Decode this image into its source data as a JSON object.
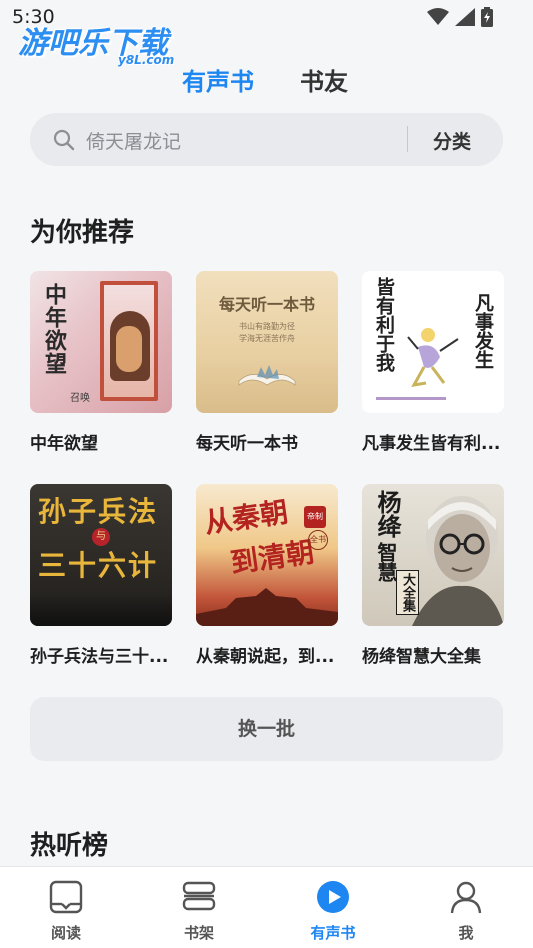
{
  "status_bar": {
    "time": "5:30",
    "icons": [
      "wifi-icon",
      "signal-icon",
      "battery-icon"
    ]
  },
  "watermark": {
    "main": "游吧乐下载",
    "sub": "y8L.com"
  },
  "top_tabs": [
    {
      "label": "有声书",
      "active": true
    },
    {
      "label": "书友",
      "active": false
    }
  ],
  "search": {
    "placeholder": "倚天屠龙记",
    "category_label": "分类"
  },
  "recommend": {
    "title": "为你推荐",
    "books": [
      {
        "title": "中年欲望",
        "cover_text": "中年欲望",
        "cover_author": "召唤"
      },
      {
        "title": "每天听一本书",
        "cover_text": "每天听一本书",
        "cover_sub1": "书山有路勤为径",
        "cover_sub2": "学海无涯苦作舟"
      },
      {
        "title": "凡事发生皆有利...",
        "cover_text1": "凡事发生",
        "cover_text2": "皆有利于我"
      },
      {
        "title": "孙子兵法与三十...",
        "cover_text1": "孙子兵法",
        "cover_mid": "与",
        "cover_text2": "三十六计"
      },
      {
        "title": "从秦朝说起，到...",
        "cover_text1": "从秦朝",
        "cover_text2": "到清朝",
        "cover_badge1": "帝制",
        "cover_badge2": "全书"
      },
      {
        "title": "杨绛智慧大全集",
        "cover_text1": "杨绛",
        "cover_text2": "智慧",
        "cover_text3": "大全集"
      }
    ]
  },
  "refresh_label": "换一批",
  "hot": {
    "title": "热听榜"
  },
  "bottom_nav": [
    {
      "label": "阅读",
      "icon": "tablet-icon",
      "active": false
    },
    {
      "label": "书架",
      "icon": "bookshelf-icon",
      "active": false
    },
    {
      "label": "有声书",
      "icon": "play-icon",
      "active": true
    },
    {
      "label": "我",
      "icon": "person-icon",
      "active": false
    }
  ],
  "colors": {
    "accent": "#1e86f0",
    "background": "#f5f6f8",
    "search_bg": "#e9eaed"
  }
}
